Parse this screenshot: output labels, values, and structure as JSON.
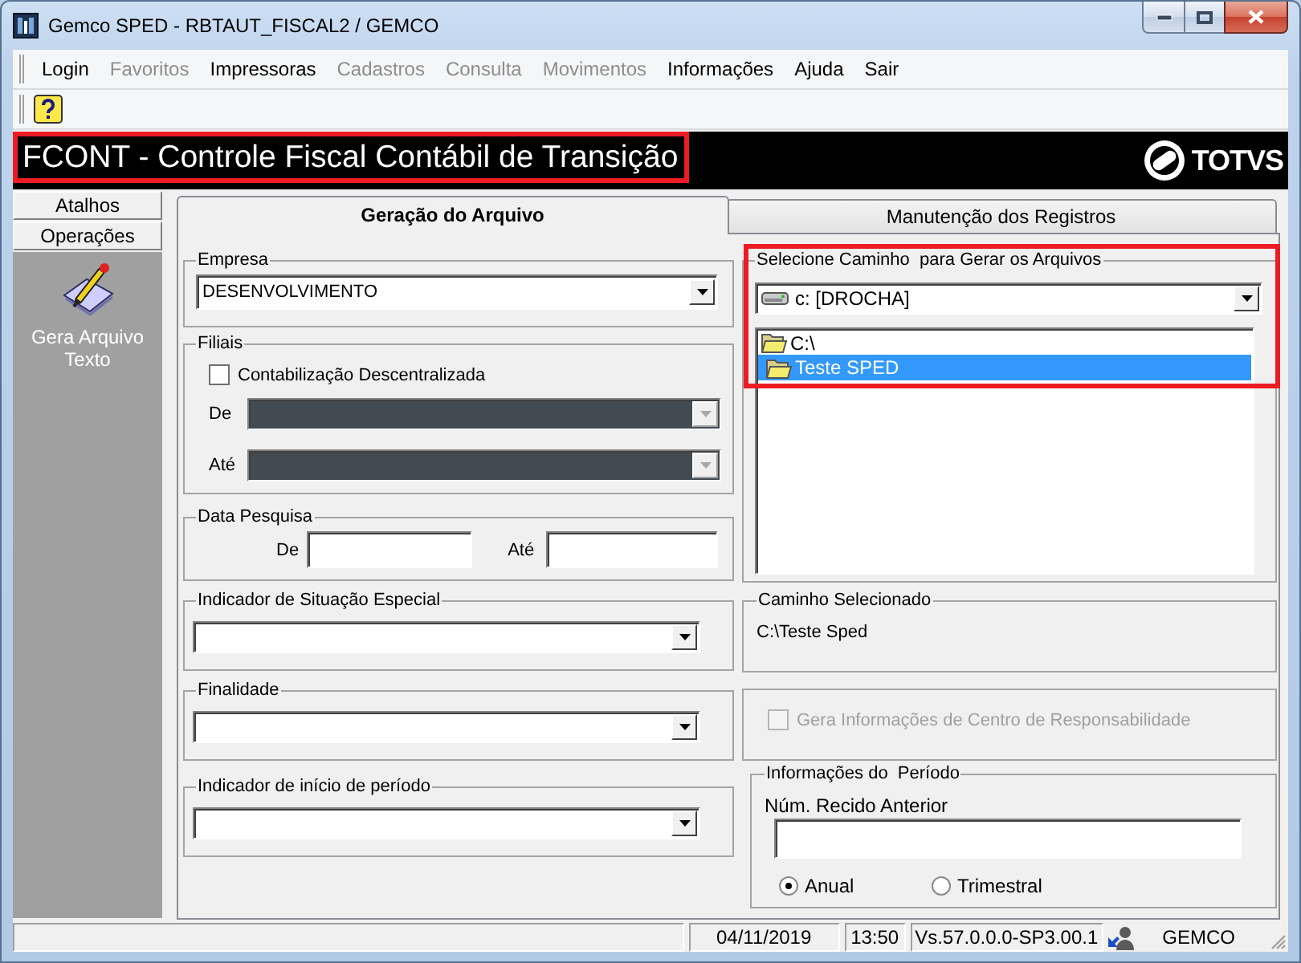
{
  "window": {
    "title": "Gemco SPED - RBTAUT_FISCAL2 / GEMCO"
  },
  "menu": [
    {
      "label": "Login",
      "disabled": false
    },
    {
      "label": "Favoritos",
      "disabled": true
    },
    {
      "label": "Impressoras",
      "disabled": false
    },
    {
      "label": "Cadastros",
      "disabled": true
    },
    {
      "label": "Consulta",
      "disabled": true
    },
    {
      "label": "Movimentos",
      "disabled": true
    },
    {
      "label": "Informações",
      "disabled": false
    },
    {
      "label": "Ajuda",
      "disabled": false
    },
    {
      "label": "Sair",
      "disabled": false
    }
  ],
  "header": {
    "title": "FCONT - Controle Fiscal Contábil de Transição",
    "highlighted": true,
    "logo_text": "TOTVS"
  },
  "sidebar": {
    "sections": [
      {
        "label": "Atalhos"
      },
      {
        "label": "Operações"
      }
    ],
    "items": [
      {
        "label": "Gera Arquivo Texto"
      }
    ]
  },
  "tabs": [
    {
      "label": "Geração do Arquivo",
      "selected": true
    },
    {
      "label": "Manutenção dos Registros",
      "selected": false
    }
  ],
  "company": {
    "label": "Empresa",
    "value": "DESENVOLVIMENTO"
  },
  "branches": {
    "label": "Filiais",
    "checkbox": {
      "label": "Contabilização Descentralizada",
      "checked": false
    },
    "fields": [
      {
        "label": "De",
        "disabled": true
      },
      {
        "label": "Até",
        "disabled": true
      }
    ]
  },
  "search_date": {
    "label": "Data Pesquisa",
    "fields": [
      {
        "label": "De"
      },
      {
        "label": "Até"
      }
    ]
  },
  "indicators": [
    {
      "label": "Indicador de Situação Especial"
    },
    {
      "label": "Finalidade"
    },
    {
      "label": "Indicador de início de período"
    }
  ],
  "path_selector": {
    "label": "Selecione Caminho  para Gerar os Arquivos",
    "highlighted": true,
    "drive": "c: [DROCHA]",
    "folders": [
      {
        "label": "C:\\",
        "selected": false,
        "children": [
          {
            "label": "Teste SPED",
            "selected": true
          }
        ]
      }
    ]
  },
  "selected_path": {
    "label": "Caminho Selecionado",
    "value": "C:\\Teste Sped"
  },
  "responsibility": {
    "label": "Gera Informações de Centro de Responsabilidade",
    "checked": false,
    "disabled": true
  },
  "period": {
    "label": "Informações do  Período",
    "field_label": "Núm. Recido Anterior",
    "options": [
      {
        "label": "Anual",
        "selected": true
      },
      {
        "label": "Trimestral",
        "selected": false
      }
    ]
  },
  "status_bar": {
    "date": "04/11/2019",
    "time": "13:50",
    "version": "Vs.57.0.0.0-SP3.00.1",
    "user": "GEMCO"
  }
}
